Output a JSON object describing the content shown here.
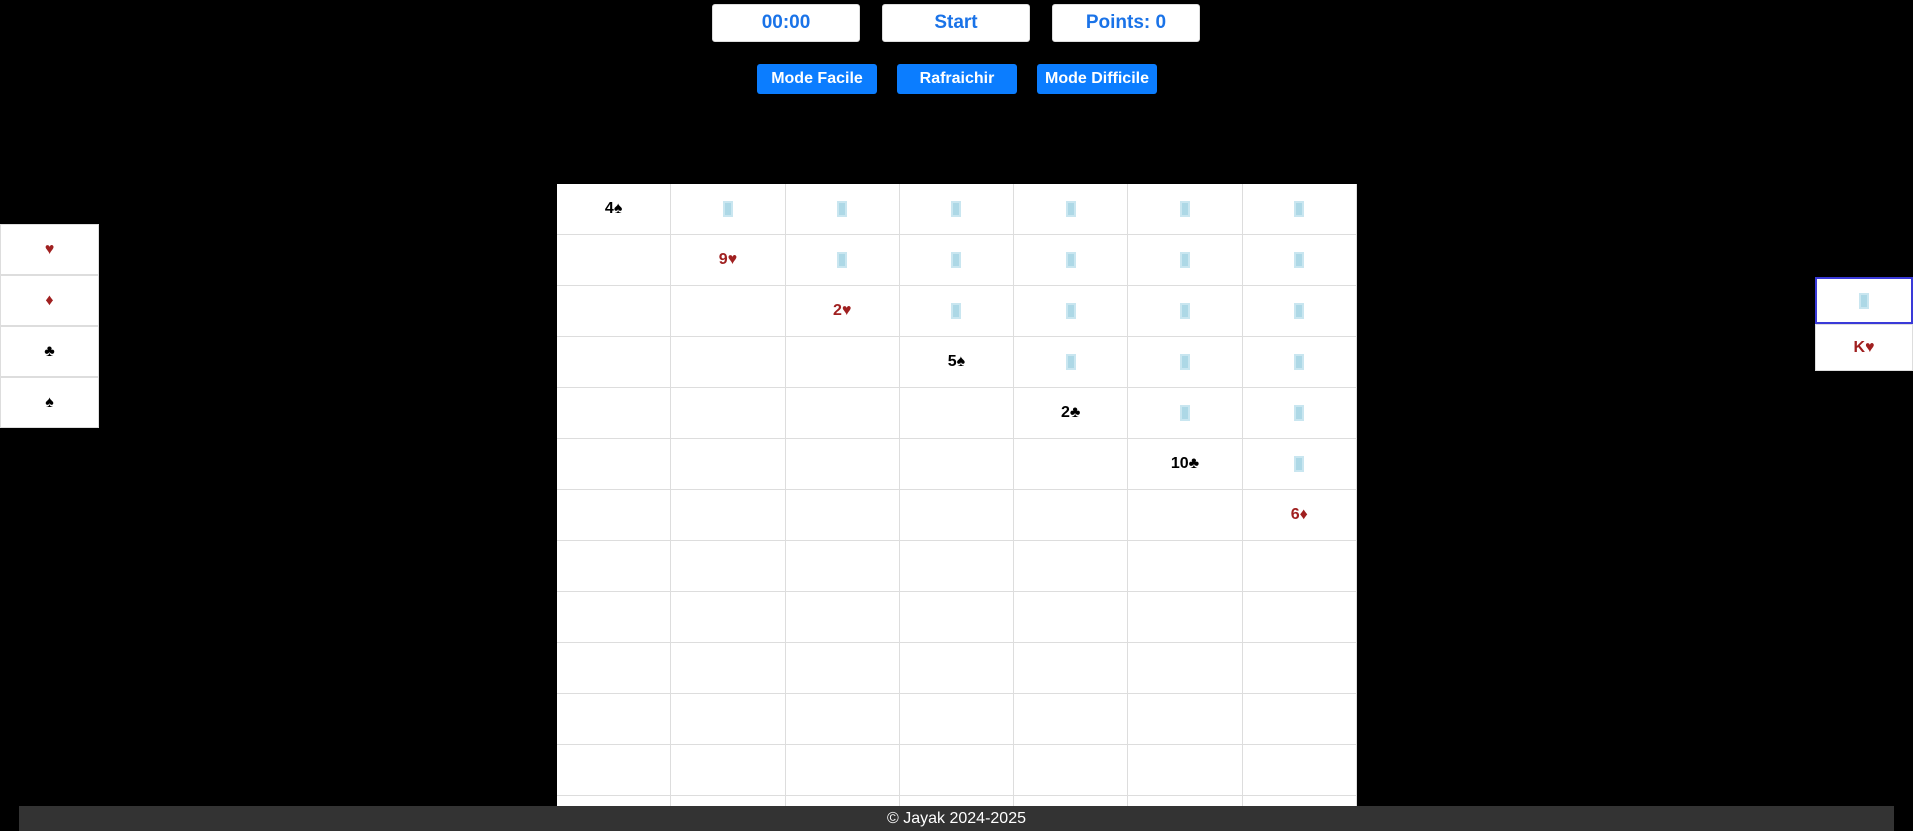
{
  "top": {
    "timer": "00:00",
    "start": "Start",
    "points": "Points: 0"
  },
  "buttons": {
    "easy": "Mode Facile",
    "refresh": "Rafraichir",
    "hard": "Mode Difficile"
  },
  "foundations": [
    {
      "symbol": "♥",
      "color": "red"
    },
    {
      "symbol": "♦",
      "color": "red"
    },
    {
      "symbol": "♣",
      "color": "black"
    },
    {
      "symbol": "♠",
      "color": "black"
    }
  ],
  "stock": {
    "top": "back",
    "waste": {
      "label": "K♥",
      "color": "red"
    }
  },
  "tableau": {
    "rows": 13,
    "columns": [
      {
        "face_down": 0,
        "face_up": {
          "label": "4♠",
          "color": "black"
        }
      },
      {
        "face_down": 1,
        "face_up": {
          "label": "9♥",
          "color": "red"
        }
      },
      {
        "face_down": 2,
        "face_up": {
          "label": "2♥",
          "color": "red"
        }
      },
      {
        "face_down": 3,
        "face_up": {
          "label": "5♠",
          "color": "black"
        }
      },
      {
        "face_down": 4,
        "face_up": {
          "label": "2♣",
          "color": "black"
        }
      },
      {
        "face_down": 5,
        "face_up": {
          "label": "10♣",
          "color": "black"
        }
      },
      {
        "face_down": 6,
        "face_up": {
          "label": "6♦",
          "color": "red"
        }
      }
    ]
  },
  "footer": "© Jayak 2024-2025"
}
